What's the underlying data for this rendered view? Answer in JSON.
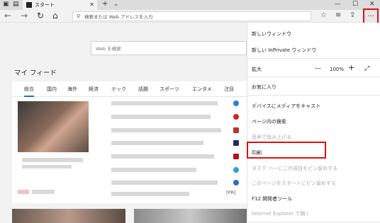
{
  "window": {
    "tab_title": "スタート",
    "new_tab": "+",
    "tab_menu": "⌄",
    "minimize": "—",
    "maximize": "☐",
    "close": "✕"
  },
  "toolbar": {
    "back": "←",
    "forward": "→",
    "refresh": "↻",
    "home": "⌂",
    "address_placeholder": "検索または Web アドレスを入力",
    "more": "···"
  },
  "page": {
    "search_placeholder": "Web を検索",
    "feed_title": "マイ フィード",
    "categories": [
      "総合",
      "国内",
      "海外",
      "経済",
      "テック",
      "話題",
      "スポーツ",
      "エンタメ",
      "注目"
    ],
    "pr_label": "[PR]"
  },
  "menu": {
    "new_window": "新しいウィンドウ",
    "new_inprivate": "新しい InPrivate ウィンドウ",
    "zoom_label": "拡大",
    "zoom_minus": "—",
    "zoom_value": "100%",
    "zoom_plus": "+",
    "zoom_full": "⤢",
    "favorites": "お気に入り",
    "cast": "デバイスにメディアをキャスト",
    "find": "ページ内の検索",
    "read_aloud": "音声で読み上げる",
    "print": "印刷",
    "pin_taskbar": "タスク バーにこの項目をピン留めする",
    "pin_start": "このページをスタートにピン留めする",
    "devtools": "F12 開発者ツール",
    "open_ie": "Internet Explorer で開く"
  },
  "colors": {
    "highlight": "#e01010",
    "accent": "#1e6fd9"
  }
}
